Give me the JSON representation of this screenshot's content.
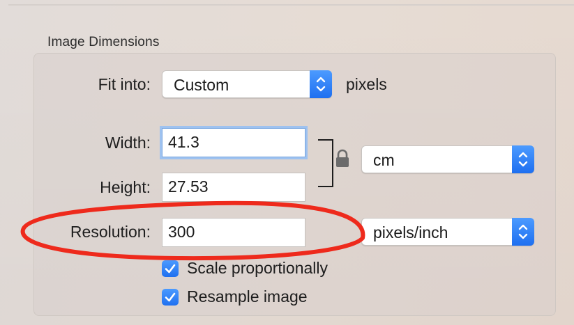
{
  "group": {
    "title": "Image Dimensions"
  },
  "fit_into": {
    "label": "Fit into:",
    "value": "Custom",
    "suffix": "pixels"
  },
  "width": {
    "label": "Width:",
    "value": "41.3"
  },
  "height": {
    "label": "Height:",
    "value": "27.53"
  },
  "size_units": {
    "value": "cm"
  },
  "resolution": {
    "label": "Resolution:",
    "value": "300",
    "units": "pixels/inch"
  },
  "options": {
    "scale_label": "Scale proportionally",
    "scale_checked": true,
    "resample_label": "Resample image",
    "resample_checked": true
  },
  "colors": {
    "accent": "#1f70f0",
    "annotation": "#ee2a1c",
    "focus_ring": "#9ec2f0"
  },
  "icons": {
    "lock": "lock-icon",
    "stepper": "chevron-up-down-icon",
    "check": "checkmark-icon"
  }
}
